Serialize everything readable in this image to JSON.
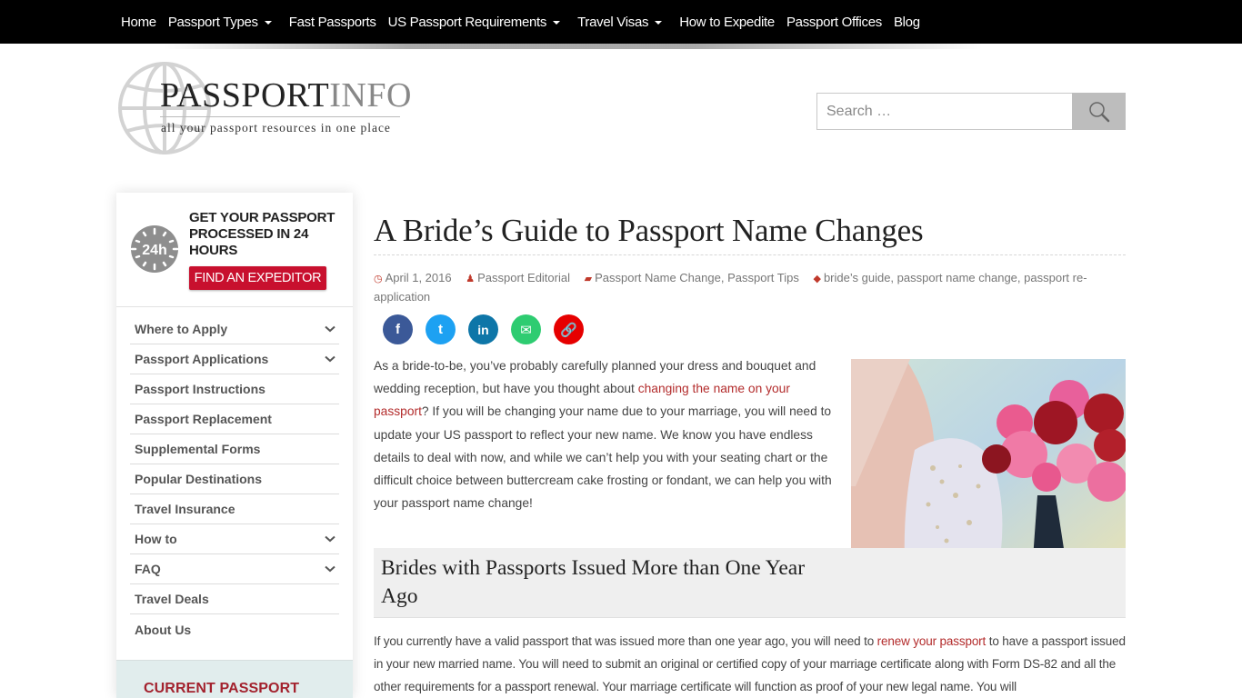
{
  "nav": {
    "items": [
      {
        "label": "Home",
        "dropdown": false
      },
      {
        "label": "Passport Types",
        "dropdown": true
      },
      {
        "label": "Fast Passports",
        "dropdown": false
      },
      {
        "label": "US Passport Requirements",
        "dropdown": true
      },
      {
        "label": "Travel Visas",
        "dropdown": true
      },
      {
        "label": "How to Expedite",
        "dropdown": false
      },
      {
        "label": "Passport Offices",
        "dropdown": false
      },
      {
        "label": "Blog",
        "dropdown": false
      }
    ]
  },
  "logo": {
    "word_main": "PASSPORT",
    "word_accent": "INFO",
    "tagline": "all your passport resources in one place"
  },
  "search": {
    "placeholder": "Search …",
    "value": "",
    "icon": "magnifier-icon"
  },
  "sidebar": {
    "promo": {
      "badge": "24h",
      "title": "GET YOUR PASSPORT PROCESSED IN 24 HOURS",
      "button": "FIND AN EXPEDITOR"
    },
    "menu": [
      {
        "label": "Where to Apply",
        "expandable": true
      },
      {
        "label": "Passport Applications",
        "expandable": true
      },
      {
        "label": "Passport Instructions",
        "expandable": false
      },
      {
        "label": "Passport Replacement",
        "expandable": false
      },
      {
        "label": "Supplemental Forms",
        "expandable": false
      },
      {
        "label": "Popular Destinations",
        "expandable": false
      },
      {
        "label": "Travel Insurance",
        "expandable": false
      },
      {
        "label": "How to",
        "expandable": true
      },
      {
        "label": "FAQ",
        "expandable": true
      },
      {
        "label": "Travel Deals",
        "expandable": false
      },
      {
        "label": "About Us",
        "expandable": false
      }
    ],
    "current_title": "CURRENT PASSPORT"
  },
  "article": {
    "title": "A Bride’s Guide to Passport Name Changes",
    "meta": {
      "date": "April 1, 2016",
      "author": "Passport Editorial",
      "categories": [
        "Passport Name Change",
        "Passport Tips"
      ],
      "tags": [
        "bride’s guide",
        "passport name change",
        "passport re-application"
      ]
    },
    "share": [
      {
        "network": "facebook",
        "glyph": "f",
        "color": "#3b5998"
      },
      {
        "network": "twitter",
        "glyph": "t",
        "color": "#1da1f2"
      },
      {
        "network": "linkedin",
        "glyph": "in",
        "color": "#0e76a8"
      },
      {
        "network": "email",
        "glyph": "✉",
        "color": "#2ecc71"
      },
      {
        "network": "copy-link",
        "glyph": "🔗",
        "color": "#e60000"
      }
    ],
    "intro": {
      "before_link": "As a bride-to-be, you’ve probably carefully planned your dress and bouquet and wedding reception, but have you thought about ",
      "link": "changing the name on your passport",
      "after_link": "? If you will be changing your name due to your marriage, you will need to update your US passport to reflect your new name. We know you have endless details to deal with now, and while we can’t help you with your seating chart or the difficult choice between buttercream cake frosting or fondant, we can help you with your passport name change!"
    },
    "image_alt": "Bride holding a bouquet of pink and red roses",
    "section_heading": "Brides with Passports Issued More than One Year Ago",
    "section_body": {
      "before_link": "If you currently have a valid passport that was issued more than one year ago, you will need to ",
      "link": "renew your passport",
      "after_link": " to have a passport issued in your new married name. You will need to submit an original or certified copy of your marriage certificate along with Form DS-82 and all the other requirements for a passport renewal. Your marriage certificate will function as proof of your new legal name. You will"
    }
  },
  "colors": {
    "accent_red": "#c8102e",
    "link_red": "#b32c2c",
    "nav_bg": "#000000"
  }
}
